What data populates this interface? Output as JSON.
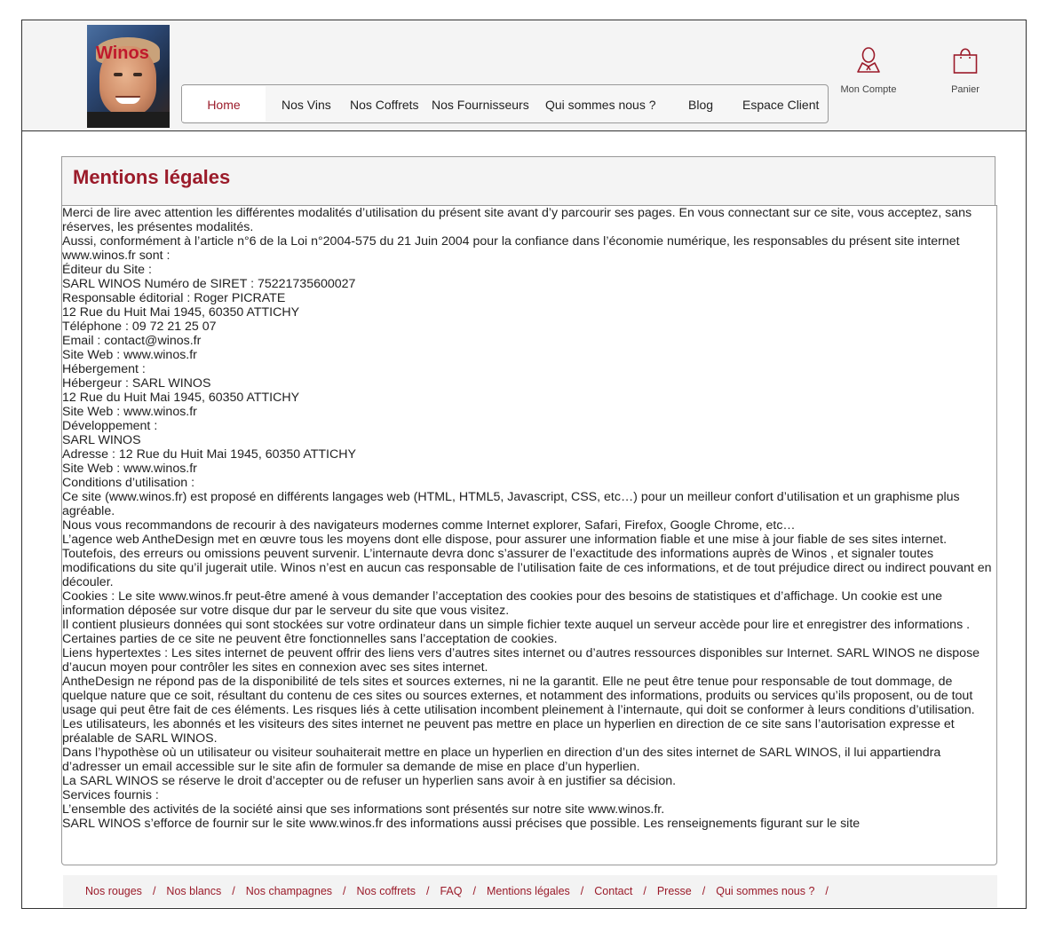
{
  "header": {
    "logo_text": "Winos",
    "nav": [
      {
        "label": "Home",
        "active": true
      },
      {
        "label": "Nos Vins"
      },
      {
        "label": "Nos Coffrets"
      },
      {
        "label": "Nos Fournisseurs"
      },
      {
        "label": "Qui sommes nous ?"
      },
      {
        "label": "Blog"
      },
      {
        "label": "Espace Client"
      }
    ],
    "account_label": "Mon Compte",
    "cart_label": "Panier"
  },
  "colors": {
    "accent": "#9b1b2a",
    "header_bg": "#f4f4f4"
  },
  "icons": {
    "account": "user-icon",
    "cart": "shopping-bag-icon"
  },
  "page": {
    "title": "Mentions légales",
    "paragraphs": [
      "Merci de lire avec attention les différentes modalités d’utilisation du présent site avant d’y parcourir ses pages. En vous connectant sur ce site, vous acceptez, sans réserves, les présentes modalités.",
      "Aussi, conformément à l’article n°6 de la Loi n°2004-575 du 21 Juin 2004 pour la confiance dans l’économie numérique, les responsables du présent site internet www.winos.fr sont :",
      "Éditeur du Site :",
      "SARL WINOS Numéro de SIRET : 75221735600027",
      "Responsable éditorial : Roger PICRATE",
      "12 Rue du Huit Mai 1945, 60350 ATTICHY",
      "Téléphone : 09 72 21 25 07",
      "Email : contact@winos.fr",
      "Site Web : www.winos.fr",
      "Hébergement :",
      "Hébergeur : SARL WINOS",
      "12 Rue du Huit Mai 1945, 60350 ATTICHY",
      "Site Web : www.winos.fr",
      "Développement :",
      "SARL WINOS",
      "Adresse : 12 Rue du Huit Mai 1945, 60350 ATTICHY",
      "Site Web : www.winos.fr",
      "Conditions d’utilisation :",
      "Ce site (www.winos.fr) est proposé en différents langages web (HTML, HTML5, Javascript, CSS, etc…) pour un meilleur confort d’utilisation et un graphisme plus agréable.",
      "Nous vous recommandons de recourir à des navigateurs modernes comme Internet explorer, Safari, Firefox, Google Chrome, etc…",
      "L’agence web AntheDesign met en œuvre tous les moyens dont elle dispose, pour assurer une information fiable et une mise à jour fiable de ses sites internet.",
      "Toutefois, des erreurs ou omissions peuvent survenir. L’internaute devra donc s’assurer de l’exactitude des informations auprès de Winos , et signaler toutes modifications du site qu’il jugerait utile. Winos n’est en aucun cas responsable de l’utilisation faite de ces informations, et de tout préjudice direct ou indirect pouvant en découler.",
      "Cookies : Le site www.winos.fr peut-être amené à vous demander l’acceptation des cookies pour des besoins de statistiques et d’affichage. Un cookie est une information déposée sur votre disque dur par le serveur du site que vous visitez.",
      "Il contient plusieurs données qui sont stockées sur votre ordinateur dans un simple fichier texte auquel un serveur accède pour lire et enregistrer des informations . Certaines parties de ce site ne peuvent être fonctionnelles sans l’acceptation de cookies.",
      "Liens hypertextes : Les sites internet de peuvent offrir des liens vers d’autres sites internet ou d’autres ressources disponibles sur Internet. SARL WINOS ne dispose d’aucun moyen pour contrôler les sites en connexion avec ses sites internet.",
      "AntheDesign ne répond pas de la disponibilité de tels sites et sources externes, ni ne la garantit. Elle ne peut être tenue pour responsable de tout dommage, de quelque nature que ce soit, résultant du contenu de ces sites ou sources externes, et notamment des informations, produits ou services qu’ils proposent, ou de tout usage qui peut être fait de ces éléments. Les risques liés à cette utilisation incombent pleinement à l’internaute, qui doit se conformer à leurs conditions d’utilisation.",
      "Les utilisateurs, les abonnés et les visiteurs des sites internet ne peuvent pas mettre en place un hyperlien en direction de ce site sans l’autorisation expresse et préalable de SARL WINOS.",
      "Dans l’hypothèse où un utilisateur ou visiteur souhaiterait mettre en place un hyperlien en direction d’un des sites internet de SARL WINOS, il lui appartiendra d’adresser un email accessible sur le site afin de formuler sa demande de mise en place d’un hyperlien.",
      "La SARL WINOS se réserve le droit d’accepter ou de refuser un hyperlien sans avoir à en justifier sa décision.",
      "Services fournis :",
      "L’ensemble des activités de la société ainsi que ses informations sont présentés sur notre site www.winos.fr.",
      "SARL WINOS s’efforce de fournir sur le site www.winos.fr des informations aussi précises que possible. Les renseignements figurant sur le site"
    ]
  },
  "footer": {
    "links": [
      "Nos rouges",
      "Nos blancs",
      "Nos champagnes",
      "Nos coffrets",
      "FAQ",
      "Mentions légales",
      "Contact",
      "Presse",
      "Qui sommes nous ?"
    ],
    "separator": "/"
  }
}
